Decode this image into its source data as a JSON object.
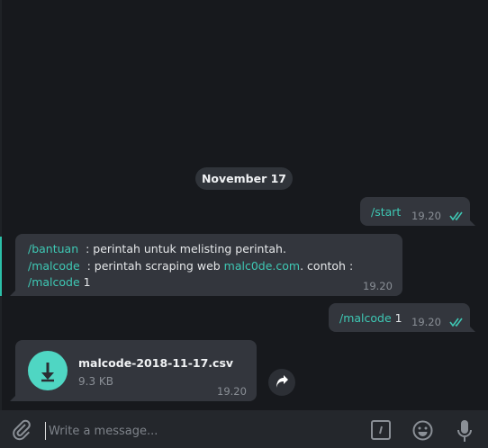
{
  "date_separator": "November 17",
  "messages": [
    {
      "type": "outgoing",
      "command": "/start",
      "time": "19.20"
    },
    {
      "type": "incoming",
      "lines": [
        {
          "cmd": "/bantuan",
          "text": "  : perintah untuk melisting perintah."
        },
        {
          "cmd": "/malcode",
          "text": "  : perintah scraping web ",
          "link": "malc0de.com",
          "after": ". contoh :"
        },
        {
          "cmd": "/malcode",
          "text": " 1"
        }
      ],
      "time": "19.20"
    },
    {
      "type": "outgoing",
      "command": "/malcode",
      "arg": " 1",
      "time": "19.20"
    },
    {
      "type": "file",
      "filename": "malcode-2018-11-17.csv",
      "size": "9.3 KB",
      "time": "19.20"
    }
  ],
  "composer": {
    "placeholder": "Write a message..."
  },
  "icons": [
    "paperclip-icon",
    "bot-command-icon",
    "emoji-icon",
    "microphone-icon",
    "download-icon",
    "share-icon",
    "double-check-icon"
  ],
  "colors": {
    "accent": "#3ec8b4",
    "bubble": "#33363d",
    "background": "#17191d"
  }
}
